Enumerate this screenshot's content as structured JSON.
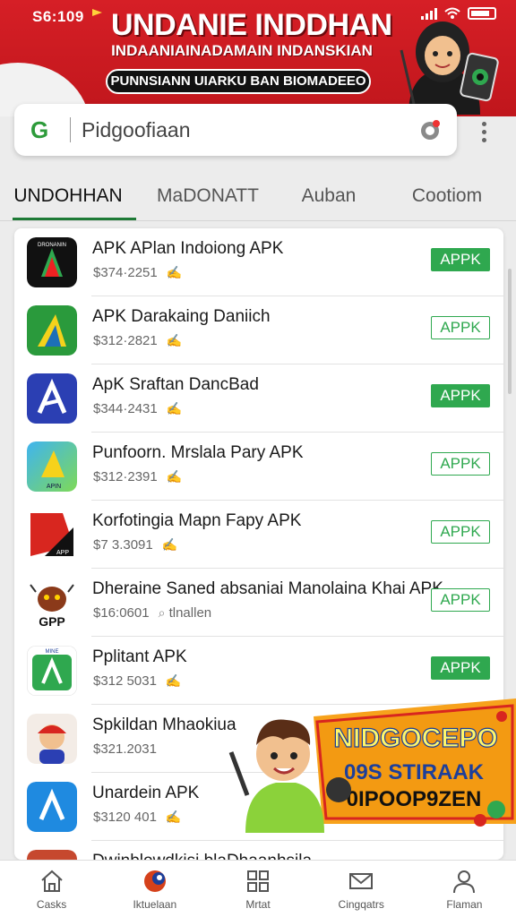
{
  "status_bar": {
    "time": "S6:109"
  },
  "banner": {
    "title": "UNDANIE INDDHAN",
    "subtitle": "INDAANIAINADAMAIN INDANSKIAN",
    "pill": "PUNNSIANN UIARKU BAN BIOMADEEO"
  },
  "search": {
    "logo": "G",
    "query": "Pidgoofiaan"
  },
  "tabs": [
    {
      "label": "UNDOHHAN",
      "active": true
    },
    {
      "label": "MaDONATT",
      "active": false
    },
    {
      "label": "Auban",
      "active": false
    },
    {
      "label": "Cootiom",
      "active": false
    }
  ],
  "apps": [
    {
      "name": "APK APlan Indoiong APK",
      "meta": "$374·2251",
      "button": "APPK",
      "button_style": "filled",
      "icon": "dark-a-logo-icon",
      "icon_label": "DRONANIN"
    },
    {
      "name": "APK Darakaing Daniich",
      "meta": "$312·2821",
      "button": "APPK",
      "button_style": "outline",
      "icon": "green-a-logo-icon",
      "icon_label": ""
    },
    {
      "name": "ApK Sraftan DancBad",
      "meta": "$344·2431",
      "button": "APPK",
      "button_style": "filled",
      "icon": "blue-a-logo-icon",
      "icon_label": ""
    },
    {
      "name": "Punfoorn. Mrslala Pary APK",
      "meta": "$312·2391",
      "button": "APPK",
      "button_style": "outline",
      "icon": "gradient-a-logo-icon",
      "icon_label": "APIN"
    },
    {
      "name": "Korfotingia Mapn Fapy APK",
      "meta": "$7 3.3091",
      "button": "APPK",
      "button_style": "outline",
      "icon": "red-black-logo-icon",
      "icon_label": "APP"
    },
    {
      "name": "Dheraine Saned absaniai Manolaina Khai APK",
      "meta": "$16:0601",
      "meta_extra": "tlnallen",
      "button": "APPK",
      "button_style": "outline",
      "icon": "bug-mascot-icon",
      "icon_label": "GPP"
    },
    {
      "name": "Pplitant APK",
      "meta": "$312 5031",
      "button": "APPK",
      "button_style": "filled",
      "icon": "green-card-logo-icon",
      "icon_label": "MINE"
    },
    {
      "name": "Spkildan Mhaokiua",
      "meta": "$321.2031",
      "button": "",
      "button_style": "none",
      "icon": "boy-avatar-icon",
      "icon_label": ""
    },
    {
      "name": "Unardein APK",
      "meta": "$3120 401",
      "button": "",
      "button_style": "none",
      "icon": "blue-round-a-icon",
      "icon_label": ""
    },
    {
      "name": "Dwinblowdkisi blaDhaanhsila",
      "meta": "",
      "button": "",
      "button_style": "none",
      "icon": "partial-app-icon",
      "icon_label": ""
    }
  ],
  "promo": {
    "line1": "NIDGOCEPO",
    "line2": "09S STIRAAK",
    "line3": "0IPOOP9ZEN"
  },
  "bottom_nav": [
    {
      "label": "Casks",
      "icon": "home-icon"
    },
    {
      "label": "Iktuelaan",
      "icon": "orb-icon"
    },
    {
      "label": "Mrtat",
      "icon": "grid-icon"
    },
    {
      "label": "Cingqatrs",
      "icon": "mail-icon"
    },
    {
      "label": "Flaman",
      "icon": "profile-icon"
    }
  ],
  "colors": {
    "brand_red": "#c8181e",
    "accent_green": "#2fa84f",
    "tab_underline": "#1e7a36"
  }
}
